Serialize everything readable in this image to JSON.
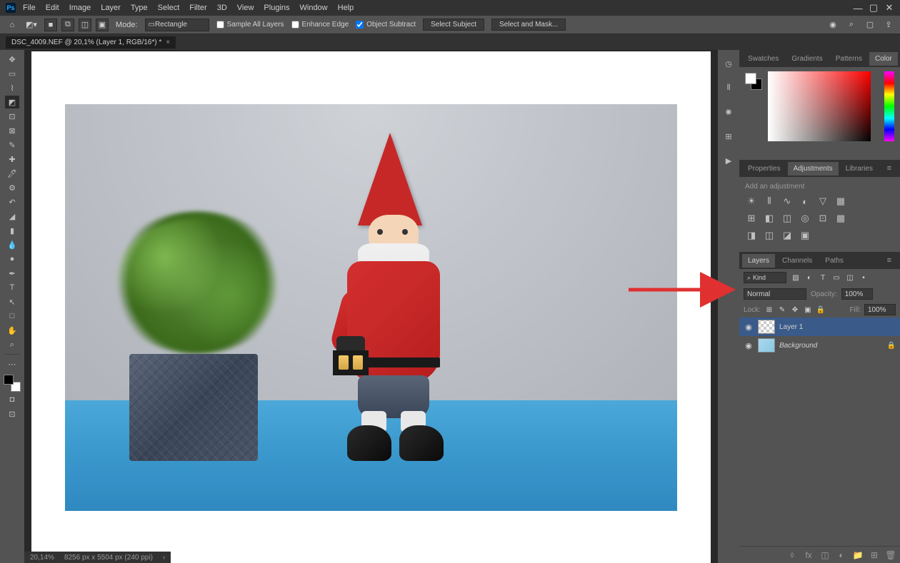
{
  "menu": {
    "file": "File",
    "edit": "Edit",
    "image": "Image",
    "layer": "Layer",
    "type": "Type",
    "select": "Select",
    "filter": "Filter",
    "threeD": "3D",
    "view": "View",
    "plugins": "Plugins",
    "window": "Window",
    "help": "Help"
  },
  "options": {
    "mode_label": "Mode:",
    "mode_value": "Rectangle",
    "sample_all_layers": "Sample All Layers",
    "enhance_edge": "Enhance Edge",
    "object_subtract": "Object Subtract",
    "select_subject": "Select Subject",
    "select_and_mask": "Select and Mask..."
  },
  "document": {
    "tab_title": "DSC_4009.NEF @ 20,1% (Layer 1, RGB/16*) *"
  },
  "status": {
    "zoom": "20,14%",
    "dims": "8256 px x 5504 px (240 ppi)"
  },
  "panels": {
    "color_tabs": {
      "swatches": "Swatches",
      "gradients": "Gradients",
      "patterns": "Patterns",
      "color": "Color"
    },
    "props_tabs": {
      "properties": "Properties",
      "adjustments": "Adjustments",
      "libraries": "Libraries"
    },
    "layers_tabs": {
      "layers": "Layers",
      "channels": "Channels",
      "paths": "Paths"
    }
  },
  "adjustments": {
    "title": "Add an adjustment"
  },
  "layers": {
    "kind": "Kind",
    "blend_mode": "Normal",
    "opacity_label": "Opacity:",
    "opacity_value": "100%",
    "lock_label": "Lock:",
    "fill_label": "Fill:",
    "fill_value": "100%",
    "items": [
      {
        "name": "Layer 1",
        "locked": false,
        "selected": true,
        "empty": true
      },
      {
        "name": "Background",
        "locked": true,
        "selected": false,
        "empty": false
      }
    ]
  }
}
